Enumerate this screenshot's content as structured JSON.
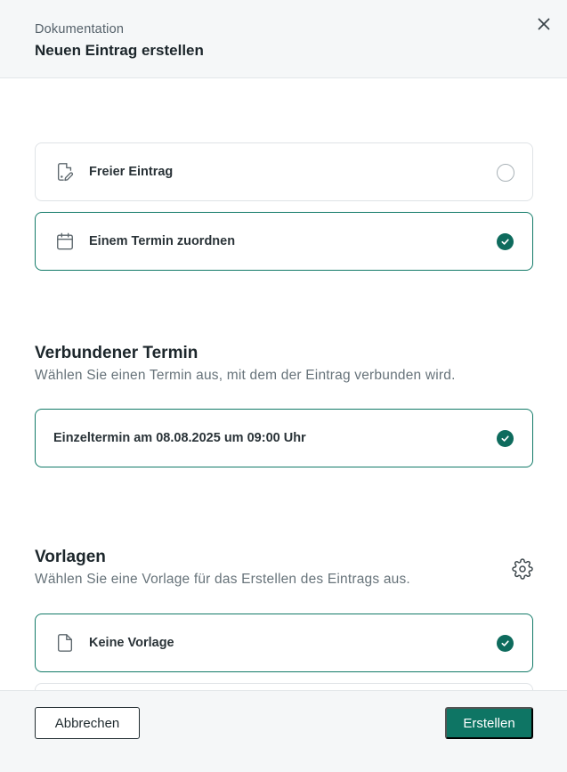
{
  "header": {
    "subtitle": "Dokumentation",
    "title": "Neuen Eintrag erstellen"
  },
  "entry_type": {
    "options": [
      {
        "label": "Freier Eintrag",
        "icon": "document-edit-icon",
        "selected": false
      },
      {
        "label": "Einem Termin zuordnen",
        "icon": "calendar-icon",
        "selected": true
      }
    ]
  },
  "appointment": {
    "title": "Verbundener Termin",
    "description": "Wählen Sie einen Termin aus, mit dem der Eintrag verbunden wird.",
    "option_label": "Einzeltermin am 08.08.2025 um 09:00 Uhr",
    "selected": true
  },
  "templates": {
    "title": "Vorlagen",
    "description": "Wählen Sie eine Vorlage für das Erstellen des Eintrags aus.",
    "settings_icon": "gear-icon",
    "options": [
      {
        "label": "Keine Vorlage",
        "icon": "file-icon",
        "selected": true
      }
    ]
  },
  "footer": {
    "cancel_label": "Abbrechen",
    "create_label": "Erstellen"
  },
  "colors": {
    "accent": "#0e7564",
    "selected_border": "#127a68",
    "header_bg": "#f5f7f8"
  }
}
